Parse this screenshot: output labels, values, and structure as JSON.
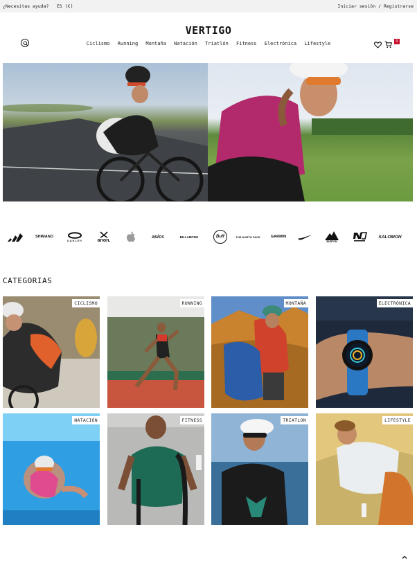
{
  "topbar": {
    "help": "¿Necesitas ayuda?",
    "language": "ES (€)",
    "account": "Iniciar sesión / Registrarse"
  },
  "header": {
    "logo": "VERTIGO",
    "cart_count": "0"
  },
  "nav": {
    "items": [
      "Ciclismo",
      "Running",
      "Montaña",
      "Natación",
      "Triatlón",
      "Fitness",
      "Electrónica",
      "Lifestyle"
    ]
  },
  "brands": [
    "adidas",
    "SHIMANO",
    "OAKLEY",
    "anon.",
    "apple",
    "asics",
    "BILLABONG",
    "Buff",
    "THE NORTH FACE",
    "GARMIN",
    "nike",
    "BURTON",
    "new balance",
    "SALOMON"
  ],
  "brand_wordmarks": {
    "shimano": "SHIMANO",
    "oakley": "OAKLEY",
    "anon": "anon.",
    "asics": "asics",
    "billabong": "BILLABONG",
    "buff": "Buff",
    "tnf": "THE NORTH FACE",
    "garmin": "GARMIN",
    "burton": "BURTON",
    "salomon": "SALOMON"
  },
  "categories": {
    "title": "CATEGORIAS",
    "items": [
      {
        "label": "CICLISMO"
      },
      {
        "label": "RUNNING"
      },
      {
        "label": "MONTAÑA"
      },
      {
        "label": "ELECTRÓNICA"
      },
      {
        "label": "NATACIÓN"
      },
      {
        "label": "FITNESS"
      },
      {
        "label": "TRIATLON"
      },
      {
        "label": "LIFESTYLE"
      }
    ]
  },
  "colors": {
    "accent": "#c8102e",
    "topbar_bg": "#f2f2f2"
  }
}
